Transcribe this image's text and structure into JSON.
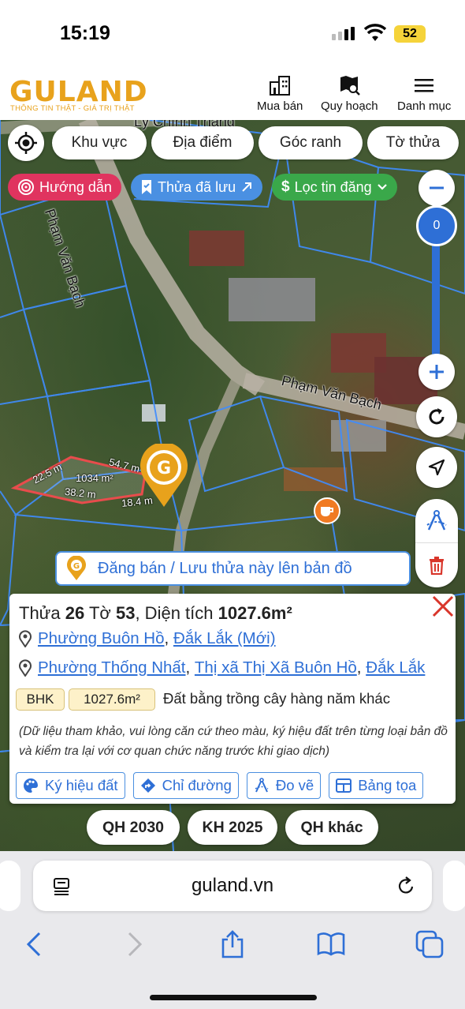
{
  "status": {
    "time": "15:19",
    "battery": "52"
  },
  "header": {
    "logo": "GULAND",
    "tagline": "THÔNG TIN THẬT - GIÁ TRỊ THẬT",
    "nav": [
      {
        "label": "Mua bán",
        "icon": "building-icon"
      },
      {
        "label": "Quy hoạch",
        "icon": "map-search-icon"
      },
      {
        "label": "Danh mục",
        "icon": "menu-icon"
      }
    ]
  },
  "map": {
    "filters": [
      "Khu vực",
      "Địa điểm",
      "Góc ranh",
      "Tờ thửa"
    ],
    "pills": {
      "guide": "Hướng dẫn",
      "saved": "Thửa đã lưu",
      "filter": "Lọc tin đăng"
    },
    "zoom_level": "0",
    "street_labels": [
      "Phạm Văn Bạch",
      "Phạm Văn Bạch",
      "Lý Chính Thắng"
    ],
    "plot": {
      "side_top": "54.7 m",
      "side_left": "22.5 m",
      "side_bottom": "38.2 m",
      "side_right": "18.4 m",
      "area": "1034 m²"
    },
    "post_button": "Đăng bán / Lưu thửa này lên bản đồ"
  },
  "card": {
    "title_prefix": "Thửa",
    "parcel": "26",
    "sheet_label": "Tờ",
    "sheet": "53",
    "area_label": ", Diện tích",
    "area": "1027.6m²",
    "location_new": {
      "ward": "Phường Buôn Hồ",
      "province": "Đắk Lắk (Mới)"
    },
    "location_old": {
      "ward": "Phường Thống Nhất",
      "town": "Thị xã Thị Xã Buôn Hồ",
      "province": "Đắk Lắk"
    },
    "land_code": "BHK",
    "land_area": "1027.6m²",
    "land_type": "Đất bằng trồng cây hàng năm khác",
    "note": "(Dữ liệu tham khảo, vui lòng căn cứ theo màu, ký hiệu đất trên từng loại bản đồ và kiểm tra lại với cơ quan chức năng trước khi giao dịch)",
    "actions": [
      "Ký hiệu đất",
      "Chỉ đường",
      "Đo vẽ",
      "Bảng tọa"
    ]
  },
  "layers": [
    "QH 2030",
    "KH 2025",
    "QH khác"
  ],
  "browser": {
    "url": "guland.vn"
  },
  "colors": {
    "brand": "#e8a21c",
    "accent": "#2e6fd6",
    "guide": "#e0345f",
    "saved": "#4a90e2",
    "filter": "#3aa84a"
  }
}
